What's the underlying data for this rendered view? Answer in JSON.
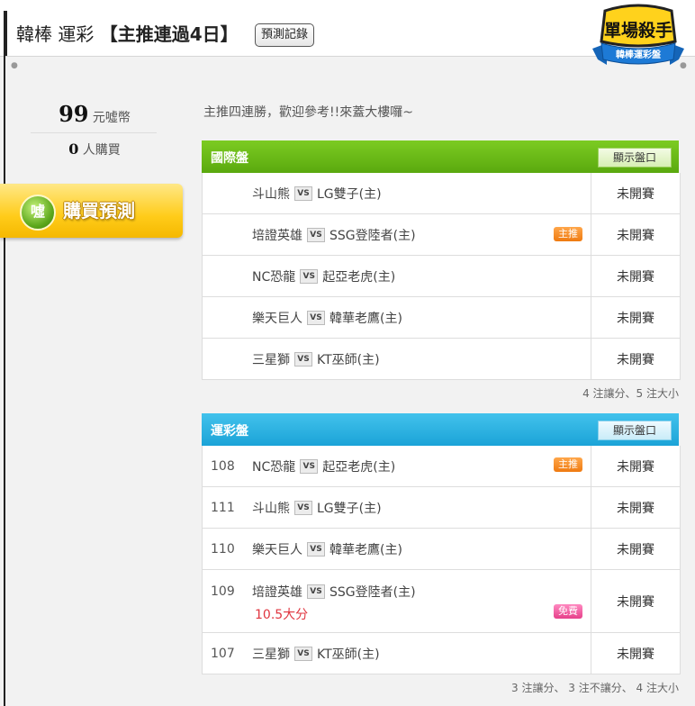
{
  "header": {
    "title_prefix": "韓棒 運彩",
    "title_highlight": "【主推連過4日】",
    "record_button": "預測記錄",
    "logo_main": "單場殺手",
    "logo_sub": "韓棒運彩盤"
  },
  "sidebar": {
    "price_value": "99",
    "price_unit": "元噓幣",
    "buyers_value": "0",
    "buyers_unit": "人購買",
    "buy_coin": "噓",
    "buy_label": "購買預測"
  },
  "intro_text": "主推四連勝，歡迎參考!!來蓋大樓囉~",
  "vs_label": "VS",
  "international": {
    "title": "國際盤",
    "show_button": "顯示盤口",
    "rows": [
      {
        "away": "斗山熊",
        "home": "LG雙子(主)",
        "badge": "",
        "status": "未開賽"
      },
      {
        "away": "培證英雄",
        "home": "SSG登陸者(主)",
        "badge": "主推",
        "status": "未開賽"
      },
      {
        "away": "NC恐龍",
        "home": "起亞老虎(主)",
        "badge": "",
        "status": "未開賽"
      },
      {
        "away": "樂天巨人",
        "home": "韓華老鷹(主)",
        "badge": "",
        "status": "未開賽"
      },
      {
        "away": "三星獅",
        "home": "KT巫師(主)",
        "badge": "",
        "status": "未開賽"
      }
    ],
    "summary": "4 注讓分、5 注大小"
  },
  "lottery": {
    "title": "運彩盤",
    "show_button": "顯示盤口",
    "rows": [
      {
        "code": "108",
        "away": "NC恐龍",
        "home": "起亞老虎(主)",
        "badge": "主推",
        "pick": "",
        "status": "未開賽"
      },
      {
        "code": "111",
        "away": "斗山熊",
        "home": "LG雙子(主)",
        "badge": "",
        "pick": "",
        "status": "未開賽"
      },
      {
        "code": "110",
        "away": "樂天巨人",
        "home": "韓華老鷹(主)",
        "badge": "",
        "pick": "",
        "status": "未開賽"
      },
      {
        "code": "109",
        "away": "培證英雄",
        "home": "SSG登陸者(主)",
        "badge": "免費",
        "pick": "10.5大分",
        "status": "未開賽"
      },
      {
        "code": "107",
        "away": "三星獅",
        "home": "KT巫師(主)",
        "badge": "",
        "pick": "",
        "status": "未開賽"
      }
    ],
    "summary": "3 注讓分、 3 注不讓分、 4 注大小"
  },
  "colors": {
    "international_header": "#6bbb18",
    "lottery_header": "#2bb2e2",
    "main_pick_badge": "#f58a1f",
    "free_badge": "#ee5a9c",
    "pick_text": "#e0353f",
    "buy_button": "#ffcc1a"
  }
}
